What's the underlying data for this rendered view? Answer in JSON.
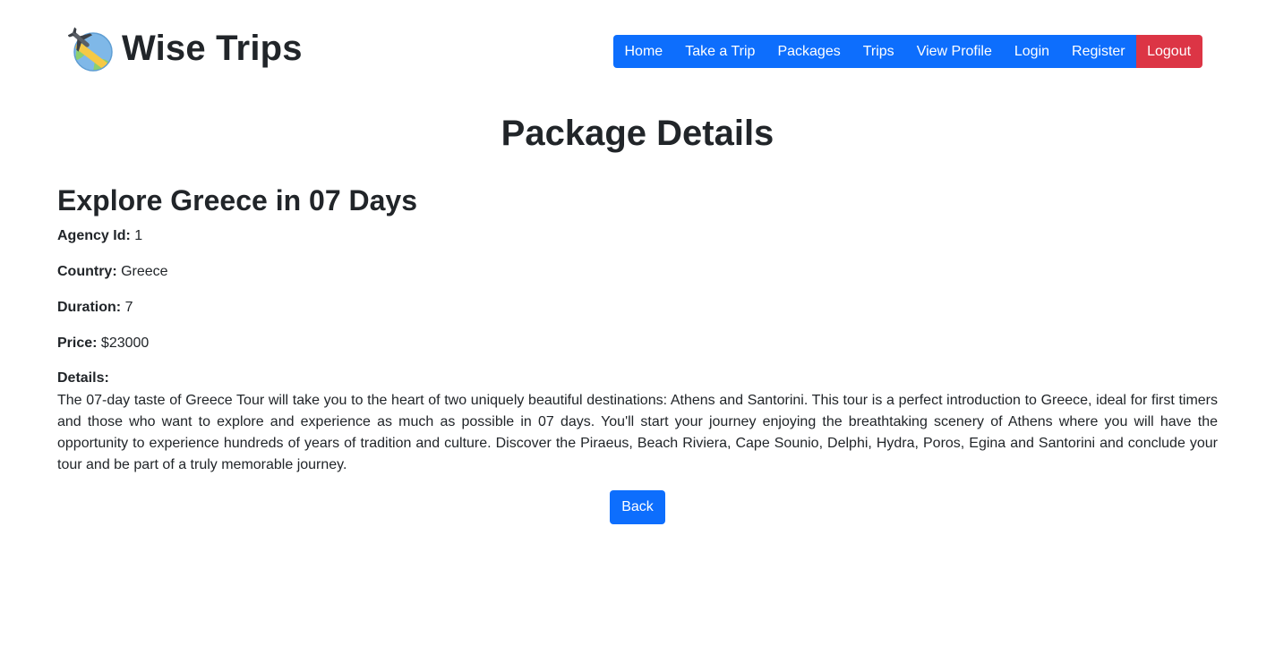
{
  "brand": {
    "title": "Wise Trips",
    "logo_icon": "globe-airplane-icon"
  },
  "nav": {
    "items": [
      {
        "label": "Home"
      },
      {
        "label": "Take a Trip"
      },
      {
        "label": "Packages"
      },
      {
        "label": "Trips"
      },
      {
        "label": "View Profile"
      },
      {
        "label": "Login"
      },
      {
        "label": "Register"
      },
      {
        "label": "Logout"
      }
    ]
  },
  "page": {
    "title": "Package Details"
  },
  "package": {
    "name": "Explore Greece in 07 Days",
    "agency_label": "Agency Id:",
    "agency_value": "1",
    "country_label": "Country:",
    "country_value": "Greece",
    "duration_label": "Duration:",
    "duration_value": "7",
    "price_label": "Price:",
    "price_value": "$23000",
    "details_label": "Details:",
    "details_text": "The 07-day taste of Greece Tour will take you to the heart of two uniquely beautiful destinations: Athens and Santorini. This tour is a perfect introduction to Greece, ideal for first timers and those who want to explore and experience as much as possible in 07 days. You'll start your journey enjoying the breathtaking scenery of Athens where you will have the opportunity to experience hundreds of years of tradition and culture. Discover the Piraeus, Beach Riviera, Cape Sounio, Delphi, Hydra, Poros, Egina and Santorini and conclude your tour and be part of a truly memorable journey."
  },
  "actions": {
    "back_label": "Back"
  },
  "colors": {
    "primary": "#0d6efd",
    "danger": "#dc3545",
    "text": "#212529"
  }
}
